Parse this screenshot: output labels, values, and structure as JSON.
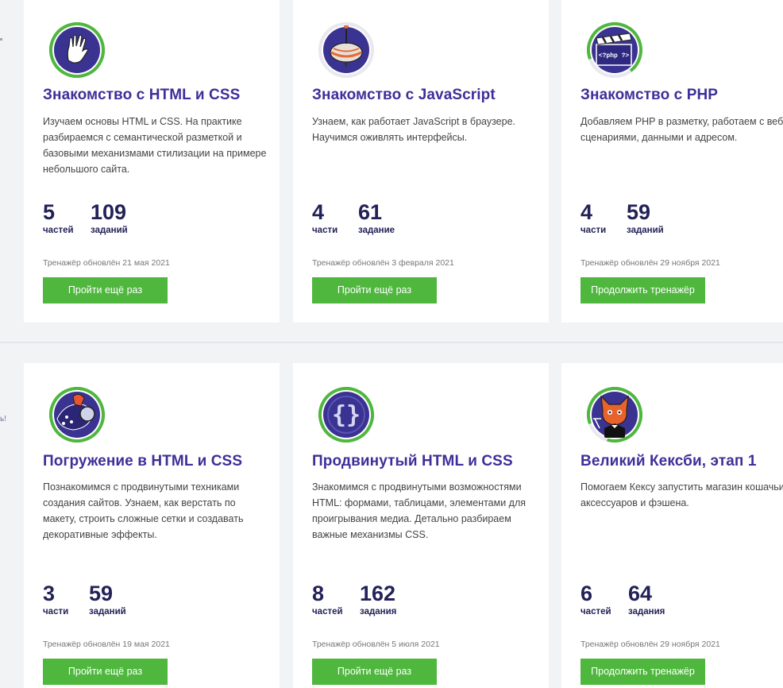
{
  "side_fragment": "ь!",
  "cards": [
    {
      "title": "Знакомство с HTML и CSS",
      "description": "Изучаем основы HTML и CSS. На практике разбираемся с семантической разметкой и базовыми механизмами стилизации на примере небольшого сайта.",
      "parts_count": "5",
      "parts_label": "частей",
      "tasks_count": "109",
      "tasks_label": "заданий",
      "updated": "Тренажёр обновлён 21 мая 2021",
      "button": "Пройти ещё раз",
      "icon": "vulcan-hand-icon",
      "progress": 1.0
    },
    {
      "title": "Знакомство с JavaScript",
      "description": "Узнаем, как работает JavaScript в браузере. Научимся оживлять интерфейсы.",
      "parts_count": "4",
      "parts_label": "части",
      "tasks_count": "61",
      "tasks_label": "задание",
      "updated": "Тренажёр обновлён 3 февраля 2021",
      "button": "Пройти ещё раз",
      "icon": "spinning-top-icon",
      "progress": 0.0
    },
    {
      "title": "Знакомство с PHP",
      "description": "Добавляем PHP в разметку, работаем с веб-сценариями, данными и адресом.",
      "parts_count": "4",
      "parts_label": "части",
      "tasks_count": "59",
      "tasks_label": "заданий",
      "updated": "Тренажёр обновлён 29 ноября 2021",
      "button": "Продолжить тренажёр",
      "icon": "php-clapperboard-icon",
      "progress": 0.7
    },
    {
      "title": "Погружение в HTML и CSS",
      "description": "Познакомимся с продвинутыми техниками создания сайтов. Узнаем, как верстать по макету, строить сложные сетки и создавать декоративные эффекты.",
      "parts_count": "3",
      "parts_label": "части",
      "tasks_count": "59",
      "tasks_label": "заданий",
      "updated": "Тренажёр обновлён 19 мая 2021",
      "button": "Пройти ещё раз",
      "icon": "diving-helmet-icon",
      "progress": 1.0
    },
    {
      "title": "Продвинутый HTML и CSS",
      "description": "Знакомимся с продвинутыми возможностями HTML: формами, таблицами, элементами для проигрывания медиа. Детально разбираем важные механизмы CSS.",
      "parts_count": "8",
      "parts_label": "частей",
      "tasks_count": "162",
      "tasks_label": "задания",
      "updated": "Тренажёр обновлён 5 июля 2021",
      "button": "Пройти ещё раз",
      "icon": "curly-braces-icon",
      "progress": 1.0
    },
    {
      "title": "Великий Кексби, этап 1",
      "description": "Помогаем Кексу запустить магазин кошачьих аксессуаров и фэшена.",
      "parts_count": "6",
      "parts_label": "частей",
      "tasks_count": "64",
      "tasks_label": "задания",
      "updated": "Тренажёр обновлён 29 ноября 2021",
      "button": "Продолжить тренажёр",
      "icon": "gatsby-cat-icon",
      "progress": 0.85
    }
  ],
  "colors": {
    "title": "#3d2f99",
    "button": "#4fb73e",
    "ring": "#4fb73e",
    "icon_bg": "#3a3391",
    "stat": "#232258"
  }
}
